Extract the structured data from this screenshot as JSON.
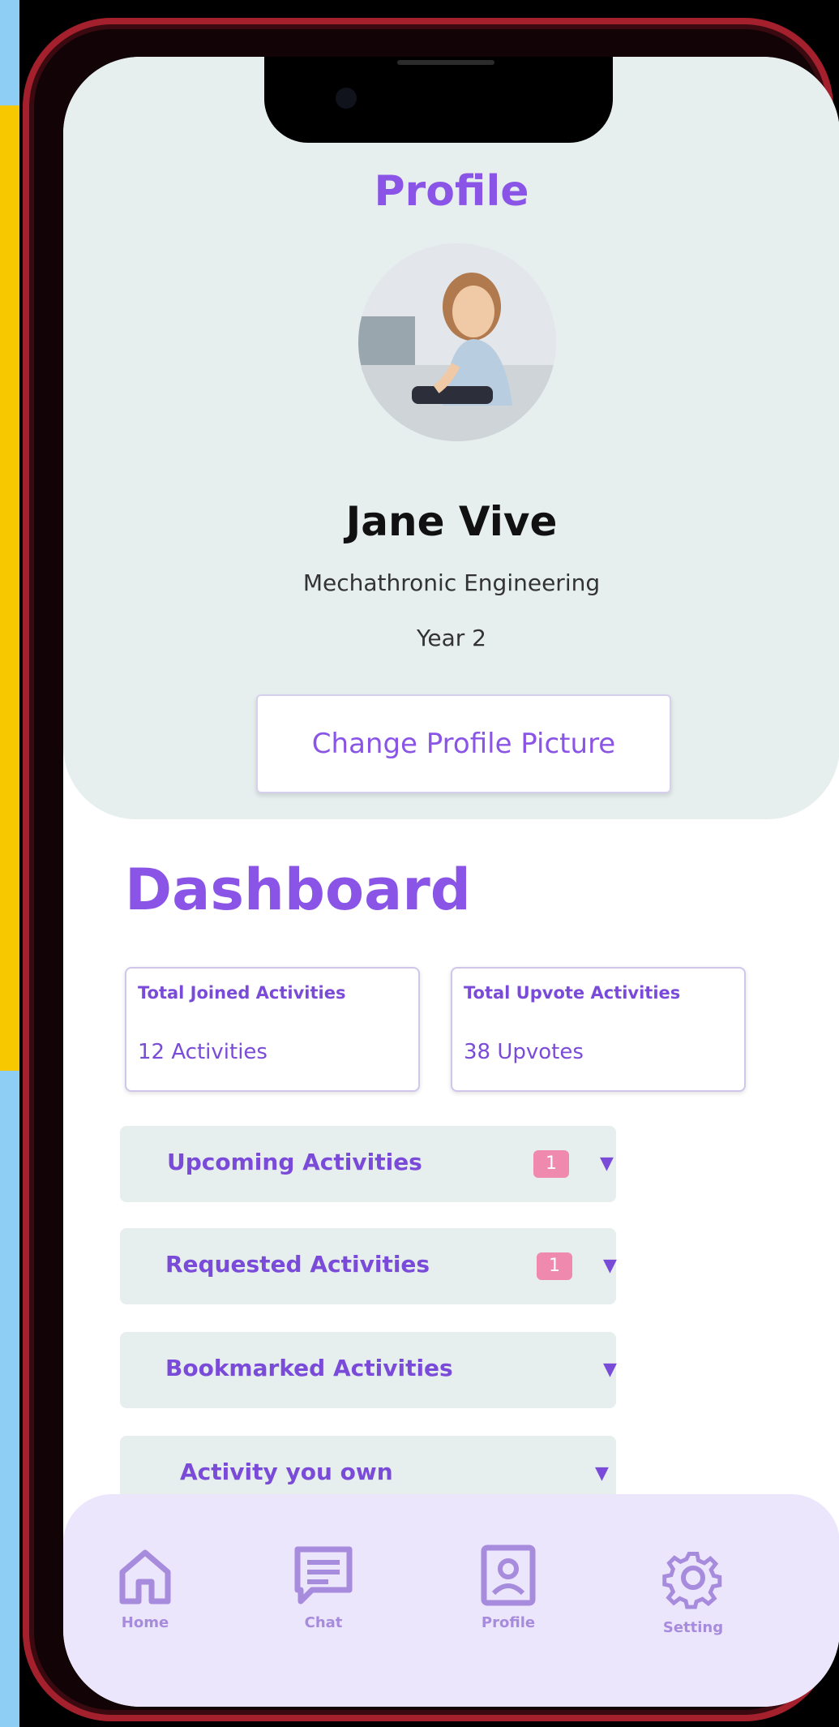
{
  "profile": {
    "title": "Profile",
    "name": "Jane Vive",
    "major": "Mechathronic Engineering",
    "year": "Year 2",
    "change_picture_label": "Change Profile Picture"
  },
  "dashboard": {
    "title": "Dashboard",
    "stats": [
      {
        "label": "Total Joined Activities",
        "value": "12 Activities"
      },
      {
        "label": "Total Upvote  Activities",
        "value": "38 Upvotes"
      }
    ],
    "sections": [
      {
        "label": "Upcoming Activities",
        "badge": "1"
      },
      {
        "label": "Requested Activities",
        "badge": "1"
      },
      {
        "label": "Bookmarked Activities",
        "badge": ""
      },
      {
        "label": "Activity you own",
        "badge": ""
      }
    ]
  },
  "nav": {
    "items": [
      {
        "label": "Home",
        "icon": "home-icon"
      },
      {
        "label": "Chat",
        "icon": "chat-icon"
      },
      {
        "label": "Profile",
        "icon": "profile-icon"
      },
      {
        "label": "Setting",
        "icon": "gear-icon"
      }
    ]
  },
  "colors": {
    "accent": "#8a55e6",
    "card_bg": "#e6eeee",
    "nav_bg": "#ece6fc",
    "badge": "#ef89ad",
    "frame": "#a3202c"
  }
}
